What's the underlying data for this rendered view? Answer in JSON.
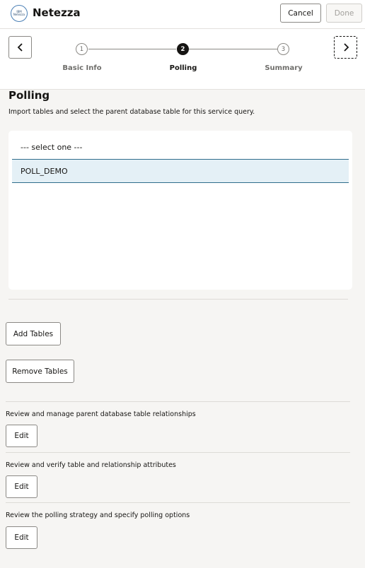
{
  "header": {
    "title": "Netezza",
    "logo_text": [
      "IBM",
      "Netezza"
    ],
    "cancel_label": "Cancel",
    "done_label": "Done"
  },
  "train": {
    "steps": [
      {
        "number": "1",
        "label": "Basic Info"
      },
      {
        "number": "2",
        "label": "Polling"
      },
      {
        "number": "3",
        "label": "Summary"
      }
    ],
    "current_step": 2
  },
  "polling": {
    "title": "Polling",
    "description": "Import tables and select the parent database table for this service query.",
    "options": [
      "--- select one ---",
      "POLL_DEMO"
    ],
    "selected": "POLL_DEMO"
  },
  "actions": {
    "add_tables": "Add Tables",
    "remove_tables": "Remove Tables",
    "relationships_label": "Review and manage parent database table relationships",
    "attributes_label": "Review and verify table and relationship attributes",
    "polling_label": "Review the polling strategy and specify polling options",
    "edit_label": "Edit"
  },
  "colors": {
    "selected_row_bg": "#e4f0f6",
    "selected_row_border": "#2f6d8c",
    "active_step": "#161513"
  }
}
